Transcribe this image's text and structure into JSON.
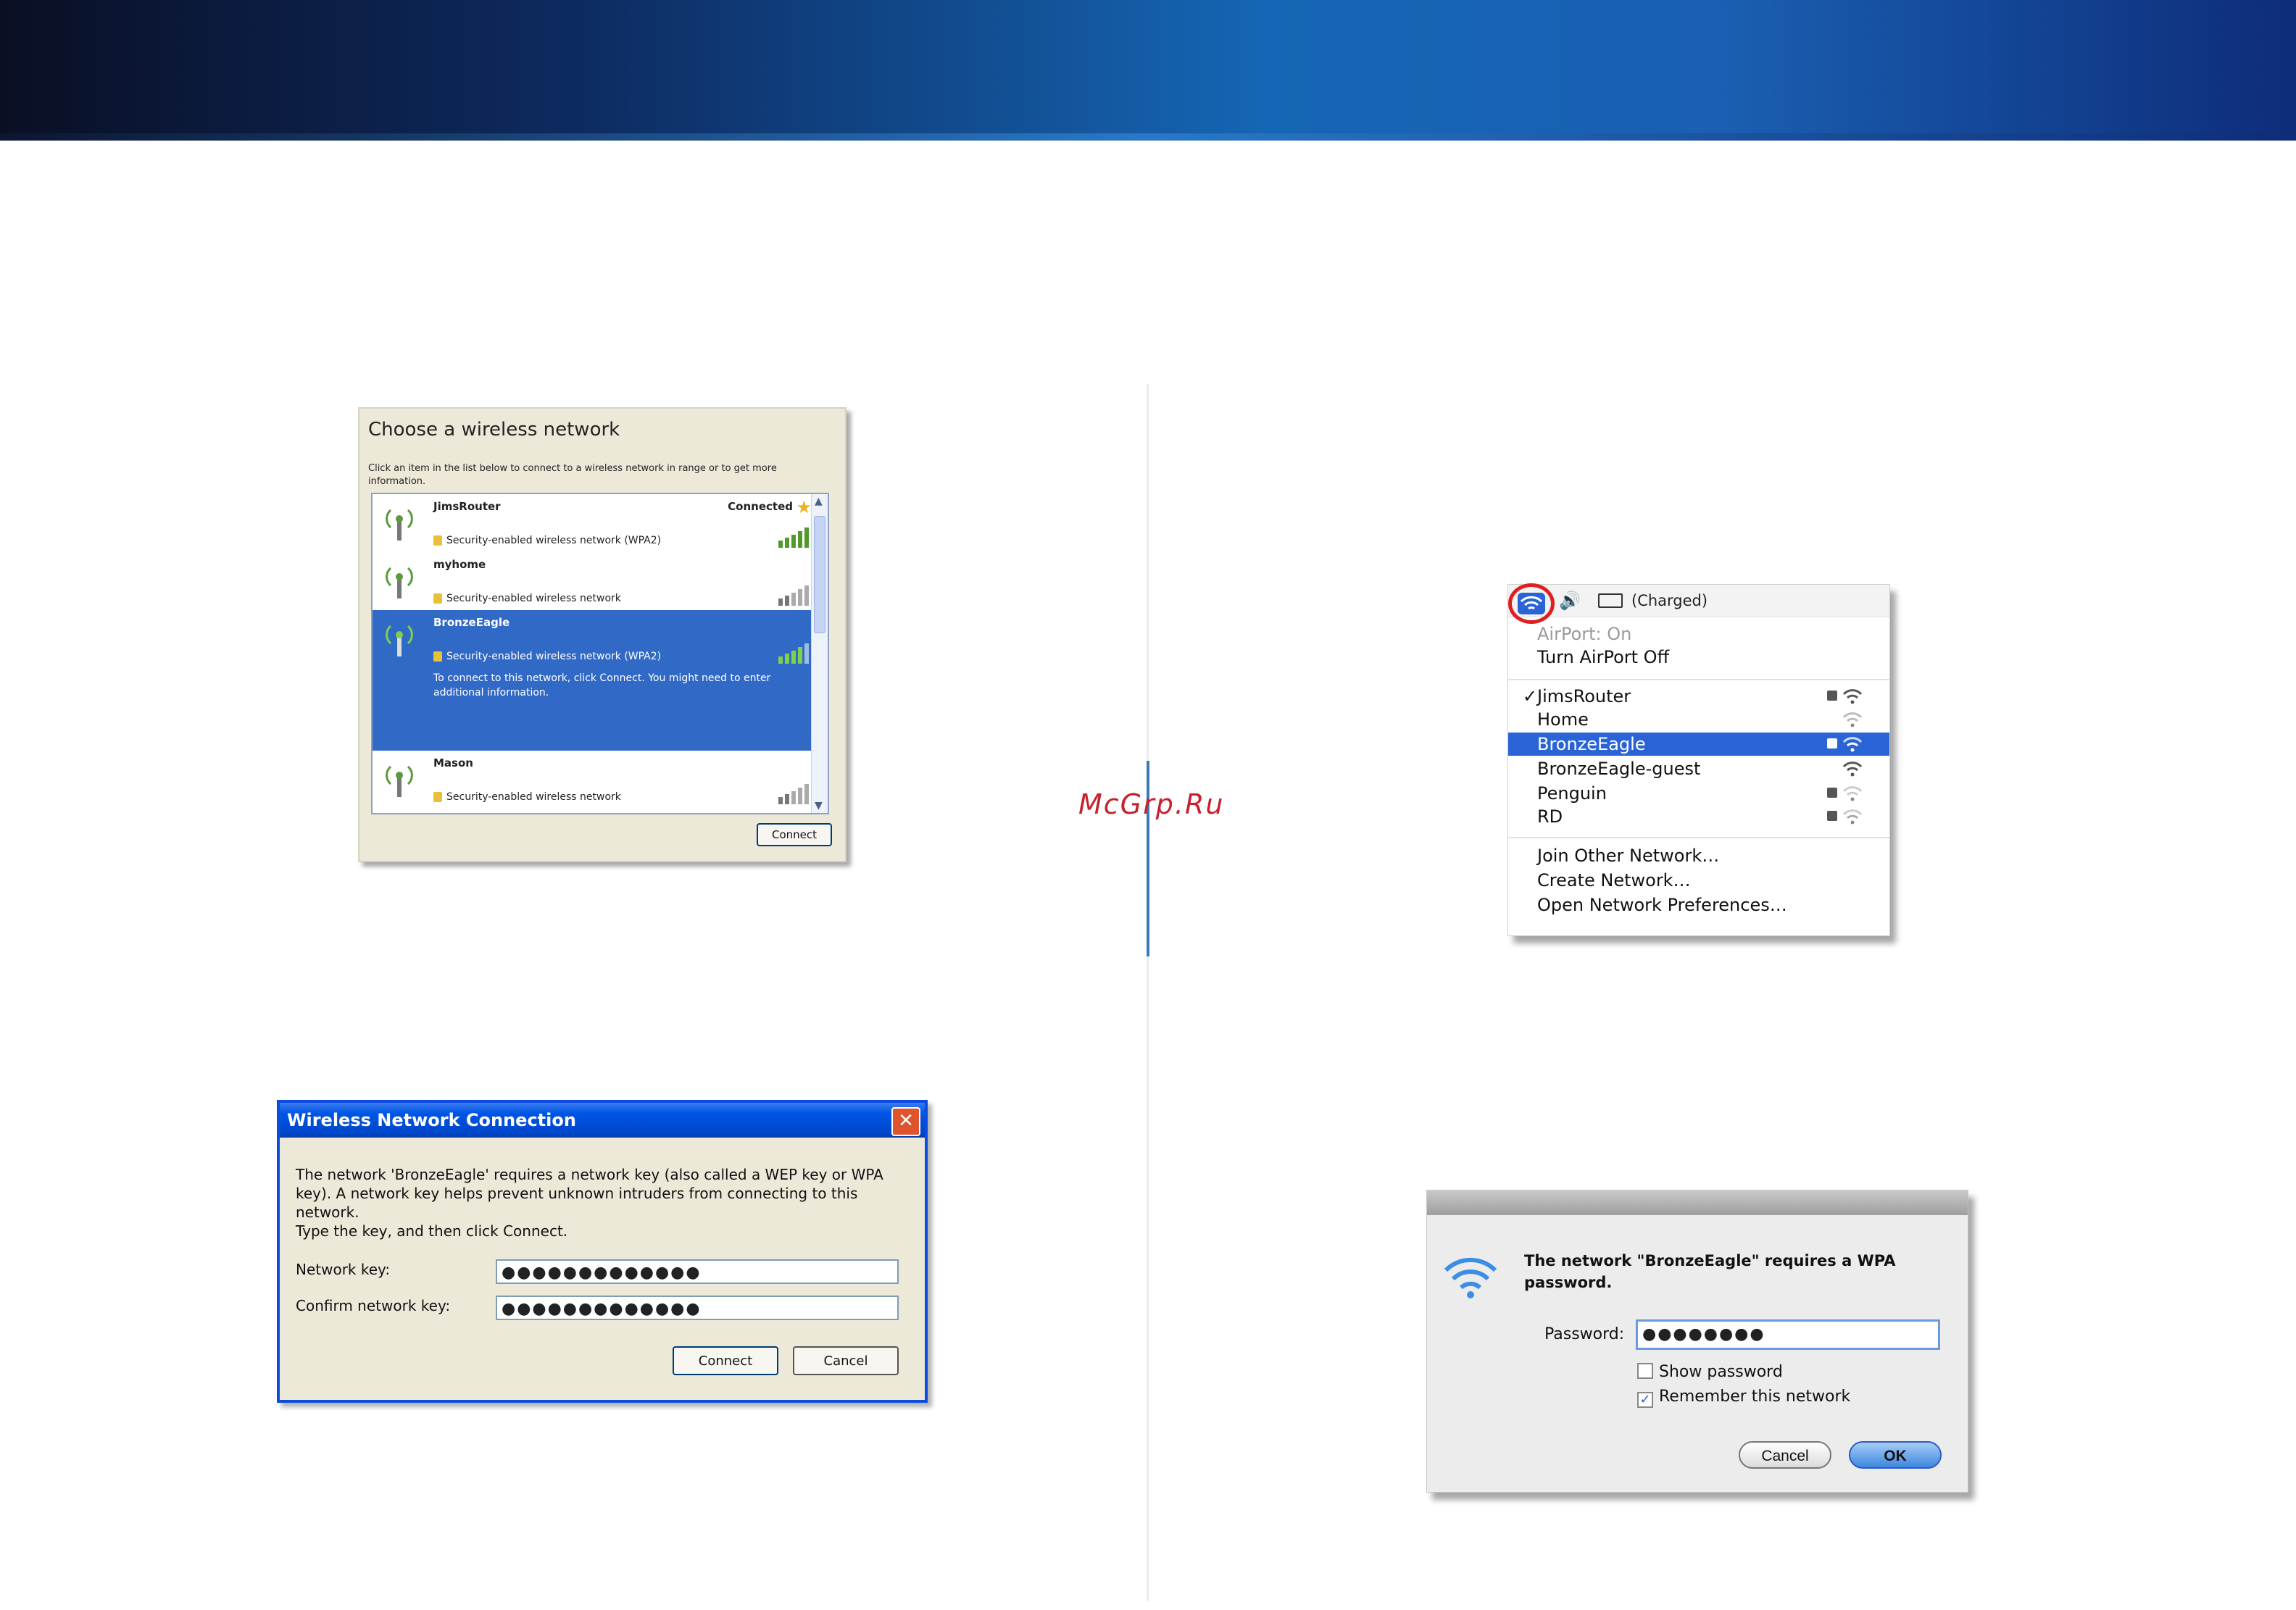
{
  "watermark": "McGrp.Ru",
  "xp_choose": {
    "title": "Choose a wireless network",
    "description": "Click an item in the list below to connect to a wireless network in range or to get more information.",
    "networks": [
      {
        "name": "JimsRouter",
        "status": "Connected",
        "security": "Security-enabled wireless network (WPA2)"
      },
      {
        "name": "myhome",
        "security": "Security-enabled wireless network"
      },
      {
        "name": "BronzeEagle",
        "security": "Security-enabled wireless network (WPA2)",
        "hint": "To connect to this network, click Connect. You might need to enter additional information."
      },
      {
        "name": "Mason",
        "security": "Security-enabled wireless network"
      }
    ],
    "connect_label": "Connect",
    "selected_color": "#3169c6"
  },
  "xp_dialog": {
    "title": "Wireless Network Connection",
    "message": "The network 'BronzeEagle' requires a network key (also called a WEP key or WPA key). A network key helps prevent unknown intruders from connecting to this network.",
    "instruction": "Type the key, and then click Connect.",
    "network_key_label": "Network key:",
    "network_key_value": "●●●●●●●●●●●●●",
    "confirm_key_label": "Confirm network key:",
    "confirm_key_value": "●●●●●●●●●●●●●",
    "connect_label": "Connect",
    "cancel_label": "Cancel"
  },
  "mac_menu": {
    "battery_status": "(Charged)",
    "airport_status": "AirPort: On",
    "turn_off": "Turn AirPort Off",
    "networks": [
      {
        "name": "JimsRouter",
        "checked": "✓",
        "locked": true
      },
      {
        "name": "Home",
        "locked": false
      },
      {
        "name": "BronzeEagle",
        "locked": true,
        "highlighted": true
      },
      {
        "name": "BronzeEagle-guest",
        "locked": false
      },
      {
        "name": "Penguin",
        "locked": true
      },
      {
        "name": "RD",
        "locked": true
      }
    ],
    "join_other": "Join Other Network…",
    "create_network": "Create Network…",
    "open_prefs": "Open Network Preferences…",
    "highlight_color": "#2a63d6"
  },
  "mac_dialog": {
    "message": "The network \"BronzeEagle\" requires a WPA password.",
    "password_label": "Password:",
    "password_value": "●●●●●●●●",
    "show_password": "Show password",
    "remember_network": "Remember this network",
    "remember_checked": "✓",
    "cancel_label": "Cancel",
    "ok_label": "OK"
  }
}
